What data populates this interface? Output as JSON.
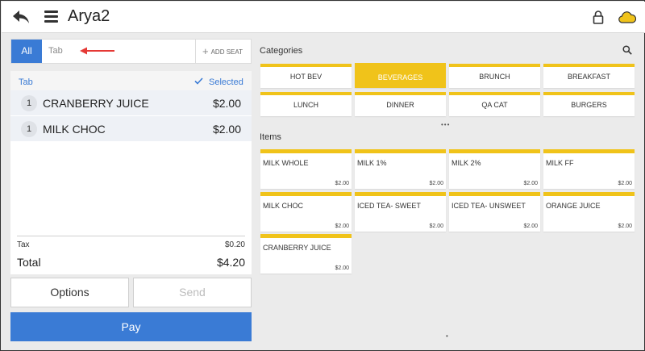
{
  "topbar": {
    "title": "Arya2"
  },
  "left": {
    "seat_bar": {
      "all_label": "All",
      "tab_placeholder": "Tab",
      "add_seat_label": "ADD SEAT"
    },
    "order": {
      "tab_label": "Tab",
      "selected_label": "Selected",
      "items": [
        {
          "qty": "1",
          "name": "CRANBERRY JUICE",
          "price": "$2.00"
        },
        {
          "qty": "1",
          "name": "MILK CHOC",
          "price": "$2.00"
        }
      ],
      "tax_label": "Tax",
      "tax_value": "$0.20",
      "total_label": "Total",
      "total_value": "$4.20"
    },
    "buttons": {
      "options": "Options",
      "send": "Send",
      "pay": "Pay"
    }
  },
  "right": {
    "categories_label": "Categories",
    "categories": [
      {
        "label": "HOT BEV",
        "active": false
      },
      {
        "label": "BEVERAGES",
        "active": true
      },
      {
        "label": "BRUNCH",
        "active": false
      },
      {
        "label": "BREAKFAST",
        "active": false
      },
      {
        "label": "LUNCH",
        "active": false
      },
      {
        "label": "DINNER",
        "active": false
      },
      {
        "label": "QA CAT",
        "active": false
      },
      {
        "label": "BURGERS",
        "active": false
      }
    ],
    "category_pager": "•••",
    "items_label": "Items",
    "items": [
      {
        "name": "MILK WHOLE",
        "price": "$2.00"
      },
      {
        "name": "MILK 1%",
        "price": "$2.00"
      },
      {
        "name": "MILK 2%",
        "price": "$2.00"
      },
      {
        "name": "MILK FF",
        "price": "$2.00"
      },
      {
        "name": "MILK CHOC",
        "price": "$2.00"
      },
      {
        "name": "ICED TEA- SWEET",
        "price": "$2.00"
      },
      {
        "name": "ICED TEA- UNSWEET",
        "price": "$2.00"
      },
      {
        "name": "ORANGE JUICE",
        "price": "$2.00"
      },
      {
        "name": "CRANBERRY JUICE",
        "price": "$2.00"
      }
    ],
    "items_pager": "•"
  },
  "colors": {
    "accent_blue": "#3a7bd5",
    "accent_yellow": "#f0c31a",
    "arrow_red": "#e53935"
  },
  "icons": [
    "back-arrow-icon",
    "hamburger-menu-icon",
    "lock-icon",
    "cloud-icon",
    "search-icon",
    "plus-icon",
    "check-icon"
  ]
}
